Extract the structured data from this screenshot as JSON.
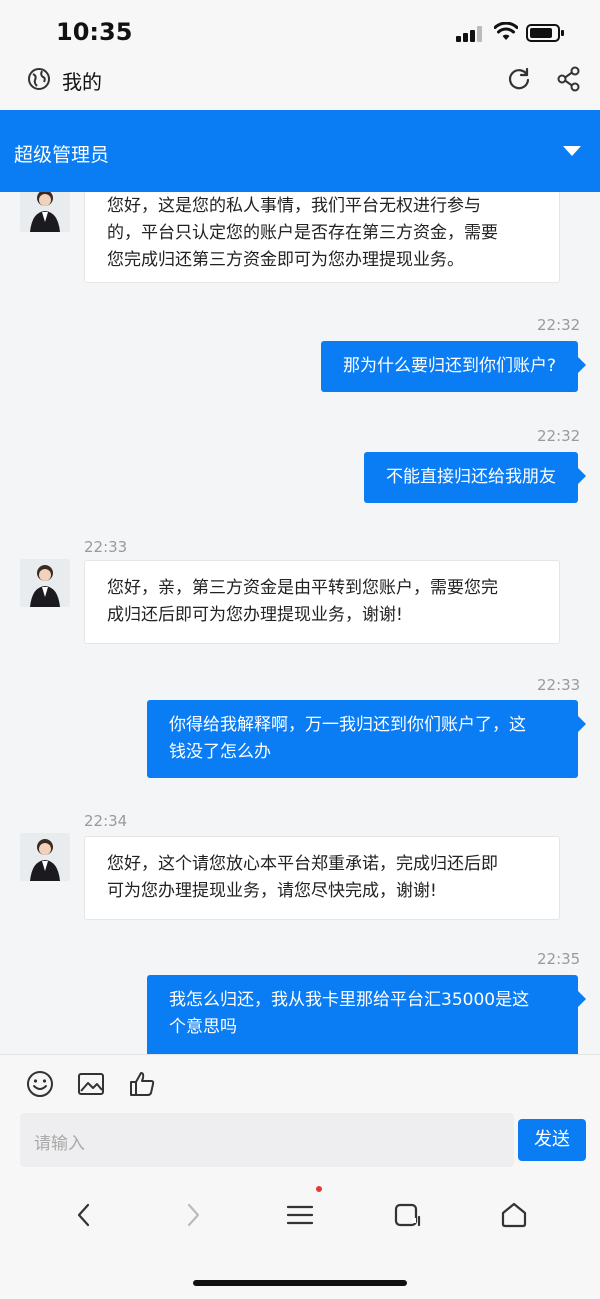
{
  "status_bar": {
    "time": "10:35"
  },
  "browser_header": {
    "title": "我的"
  },
  "role_bar": {
    "title": "超级管理员"
  },
  "messages": [
    {
      "side": "in",
      "time": "",
      "lines": [
        "您好，这是您的私人事情，我们平台无权进行参与",
        "的，平台只认定您的账户是否存在第三方资金，需要",
        "您完成归还第三方资金即可为您办理提现业务。"
      ]
    },
    {
      "side": "out",
      "time": "22:32",
      "lines": [
        "那为什么要归还到你们账户?"
      ]
    },
    {
      "side": "out",
      "time": "22:32",
      "lines": [
        "不能直接归还给我朋友"
      ]
    },
    {
      "side": "in",
      "time": "22:33",
      "lines": [
        "您好，亲，第三方资金是由平转到您账户，需要您完",
        "成归还后即可为您办理提现业务，谢谢!"
      ]
    },
    {
      "side": "out",
      "time": "22:33",
      "lines": [
        "你得给我解释啊，万一我归还到你们账户了，这",
        "钱没了怎么办"
      ]
    },
    {
      "side": "in",
      "time": "22:34",
      "lines": [
        "您好，这个请您放心本平台郑重承诺，完成归还后即",
        "可为您办理提现业务，请您尽快完成，谢谢!"
      ]
    },
    {
      "side": "out",
      "time": "22:35",
      "lines": [
        "我怎么归还，我从我卡里那给平台汇35000是这",
        "个意思吗"
      ]
    }
  ],
  "input": {
    "placeholder": "请输入",
    "send_label": "发送"
  },
  "colors": {
    "accent": "#0a7df5",
    "notification_dot": "#e53935"
  }
}
